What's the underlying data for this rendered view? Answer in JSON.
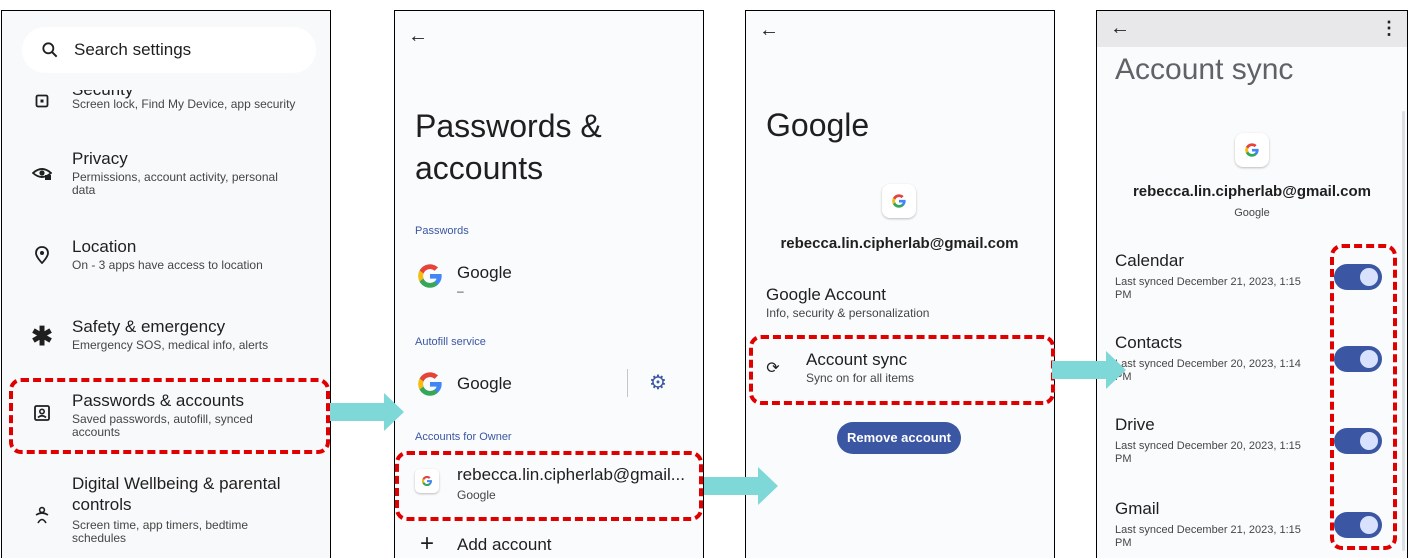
{
  "panel1": {
    "search_placeholder": "Search settings",
    "items": [
      {
        "title": "Security",
        "subtitle": "Screen lock, Find My Device, app security",
        "icon": "security-icon"
      },
      {
        "title": "Privacy",
        "subtitle": "Permissions, account activity, personal data",
        "icon": "privacy-eye-icon"
      },
      {
        "title": "Location",
        "subtitle": "On - 3 apps have access to location",
        "icon": "location-pin-icon"
      },
      {
        "title": "Safety & emergency",
        "subtitle": "Emergency SOS, medical info, alerts",
        "icon": "asterisk-icon"
      },
      {
        "title": "Passwords & accounts",
        "subtitle": "Saved passwords, autofill, synced accounts",
        "icon": "account-box-icon"
      },
      {
        "title": "Digital Wellbeing & parental controls",
        "subtitle": "Screen time, app timers, bedtime schedules",
        "icon": "wellbeing-icon"
      }
    ]
  },
  "panel2": {
    "title": "Passwords & accounts",
    "passwords_section": "Passwords",
    "password_item": {
      "title": "Google",
      "subtitle": "–"
    },
    "autofill_section": "Autofill service",
    "autofill_item": {
      "title": "Google"
    },
    "accounts_section": "Accounts for Owner",
    "account_item": {
      "title": "rebecca.lin.cipherlab@gmail...",
      "subtitle": "Google"
    },
    "add_account": "Add account"
  },
  "panel3": {
    "title": "Google",
    "email": "rebecca.lin.cipherlab@gmail.com",
    "google_account": {
      "title": "Google Account",
      "subtitle": "Info, security & personalization"
    },
    "account_sync": {
      "title": "Account sync",
      "subtitle": "Sync on for all items"
    },
    "remove_button": "Remove account"
  },
  "panel4": {
    "title": "Account sync",
    "email": "rebecca.lin.cipherlab@gmail.com",
    "provider": "Google",
    "sync_items": [
      {
        "title": "Calendar",
        "subtitle": "Last synced December 21, 2023, 1:15 PM",
        "enabled": true
      },
      {
        "title": "Contacts",
        "subtitle": "Last synced December 20, 2023, 1:14 PM",
        "enabled": true
      },
      {
        "title": "Drive",
        "subtitle": "Last synced December 20, 2023, 1:15 PM",
        "enabled": true
      },
      {
        "title": "Gmail",
        "subtitle": "Last synced December 21, 2023, 1:15 PM",
        "enabled": true
      }
    ]
  },
  "colors": {
    "accent": "#3b57a3",
    "highlight": "#e00000",
    "arrow": "#7fd8d8"
  }
}
